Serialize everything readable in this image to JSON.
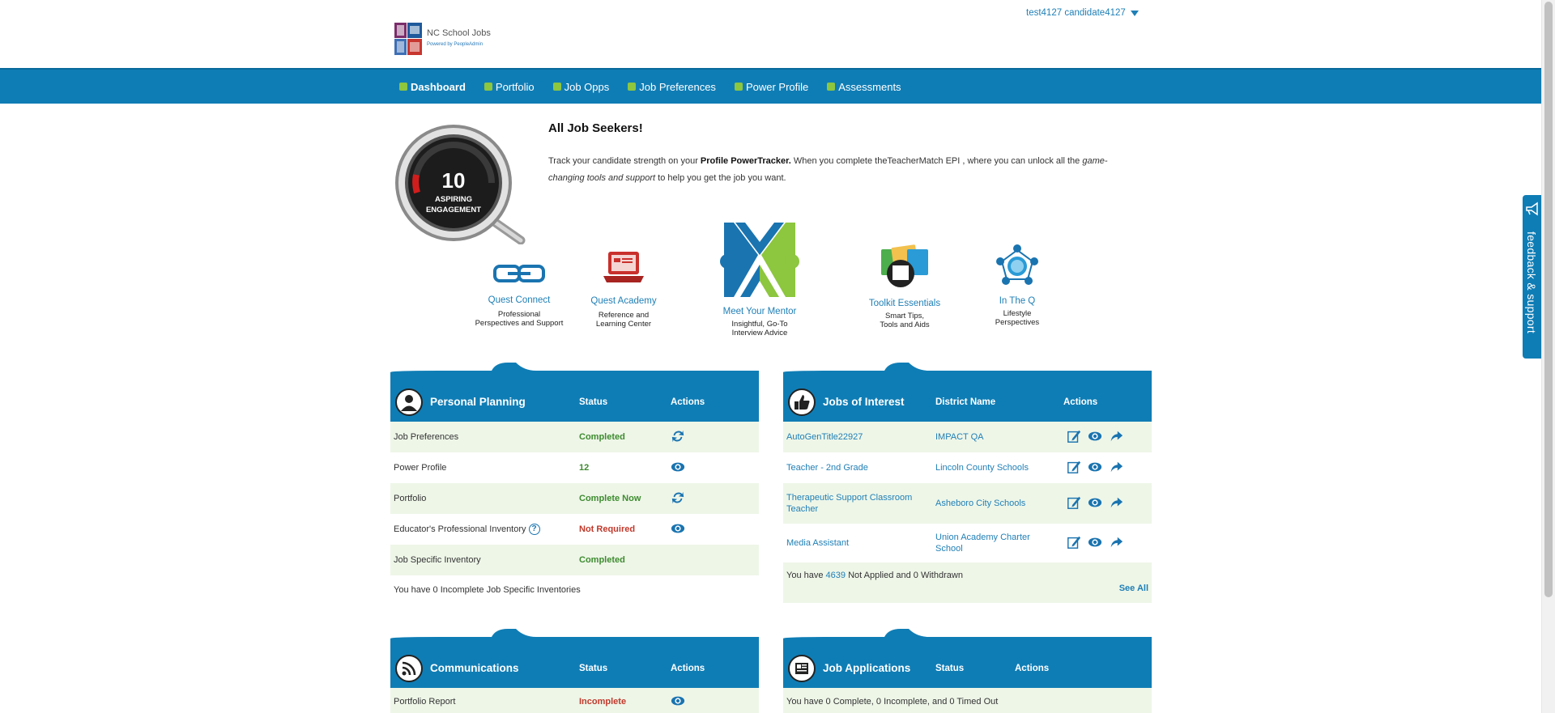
{
  "header": {
    "logo_title": "NC School Jobs",
    "logo_powered": "Powered by PeopleAdmin",
    "user_name": "test4127 candidate4127"
  },
  "nav": {
    "items": [
      "Dashboard",
      "Portfolio",
      "Job Opps",
      "Job Preferences",
      "Power Profile",
      "Assessments"
    ],
    "active": "Dashboard"
  },
  "gauge": {
    "score": "10",
    "label_line1": "ASPIRING",
    "label_line2": "ENGAGEMENT"
  },
  "hero": {
    "title": "All Job Seekers!",
    "text_a": "Track your candidate strength on your ",
    "text_b": "Profile PowerTracker.",
    "text_c": " When you complete theTeacherMatch EPI , where you can unlock all the ",
    "text_d": "game-changing tools and support",
    "text_e": " to help you get the job you want."
  },
  "tiles": [
    {
      "name": "Quest Connect",
      "desc1": "Professional",
      "desc2": "Perspectives and Support"
    },
    {
      "name": "Quest Academy",
      "desc1": "Reference and",
      "desc2": "Learning Center"
    },
    {
      "name": "Meet Your Mentor",
      "desc1": "Insightful, Go-To",
      "desc2": "Interview Advice"
    },
    {
      "name": "Toolkit Essentials",
      "desc1": "Smart Tips,",
      "desc2": "Tools and Aids"
    },
    {
      "name": "In The Q",
      "desc1": "Lifestyle",
      "desc2": "Perspectives"
    }
  ],
  "personal_planning": {
    "title": "Personal Planning",
    "col_status": "Status",
    "col_actions": "Actions",
    "rows": [
      {
        "label": "Job Preferences",
        "status": "Completed",
        "action": "refresh-icon"
      },
      {
        "label": "Power Profile",
        "status": "12",
        "action": "eye-icon"
      },
      {
        "label": "Portfolio",
        "status": "Complete Now",
        "action": "refresh-icon"
      },
      {
        "label": "Educator's Professional Inventory",
        "status": "Not Required",
        "action": "eye-icon"
      },
      {
        "label": "Job Specific Inventory",
        "status": "Completed",
        "action": ""
      }
    ],
    "footer": "You have 0 Incomplete Job Specific Inventories"
  },
  "jobs_of_interest": {
    "title": "Jobs of Interest",
    "col_district": "District Name",
    "col_actions": "Actions",
    "rows": [
      {
        "title": "AutoGenTitle22927",
        "district": "IMPACT QA"
      },
      {
        "title": "Teacher - 2nd Grade",
        "district": "Lincoln County Schools"
      },
      {
        "title": "Therapeutic Support Classroom Teacher",
        "district": "Asheboro City Schools"
      },
      {
        "title": "Media Assistant",
        "district": "Union Academy Charter School"
      }
    ],
    "footer_a": "You have ",
    "footer_count": "4639",
    "footer_b": " Not Applied and 0 Withdrawn",
    "see_all": "See All"
  },
  "communications": {
    "title": "Communications",
    "col_status": "Status",
    "col_actions": "Actions",
    "rows": [
      {
        "label": "Portfolio Report",
        "status": "Incomplete",
        "action": "eye-icon"
      }
    ]
  },
  "job_applications": {
    "title": "Job Applications",
    "col_status": "Status",
    "col_actions": "Actions",
    "footer": "You have 0 Complete, 0 Incomplete, and 0 Timed Out"
  },
  "feedback": {
    "label": "feedback & support"
  },
  "colors": {
    "brand_blue": "#0f7db5",
    "accent_green": "#8dc63f",
    "status_ok": "#3d8b2f",
    "status_bad": "#c0392b"
  }
}
